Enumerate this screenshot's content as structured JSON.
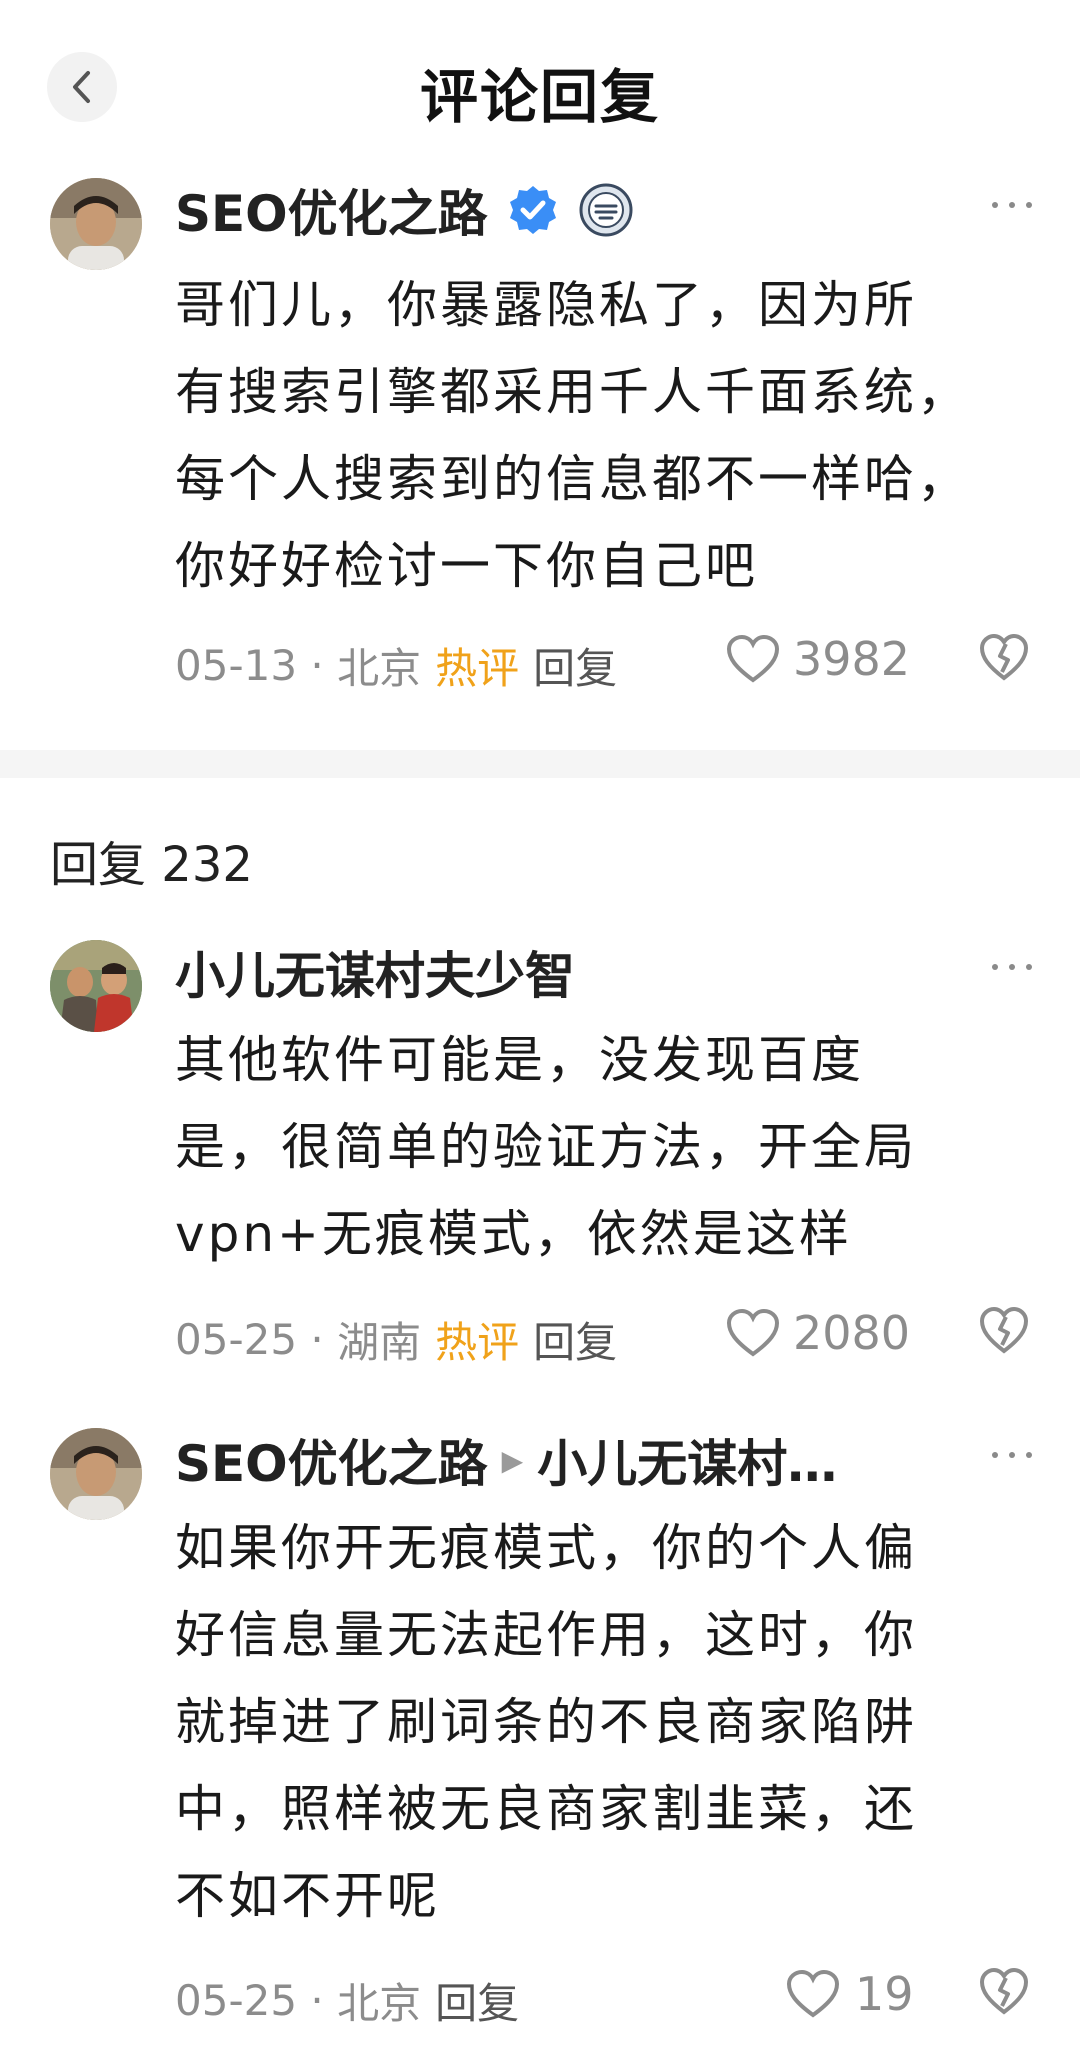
{
  "header": {
    "title": "评论回复",
    "back_icon": "chevron-left-icon"
  },
  "main_comment": {
    "author": "SEO优化之路",
    "verified_icon": "verified-badge-icon",
    "level_icon": "fan-badge-icon",
    "text_lines": [
      "哥们儿，你暴露隐私了，因为所",
      "有搜索引擎都采用千人千面系统，",
      "每个人搜索到的信息都不一样哈，",
      "你好好检讨一下你自己吧"
    ],
    "date": "05-13",
    "location": "北京",
    "hot_label": "热评",
    "reply_label": "回复",
    "likes": "3982"
  },
  "replies_header": {
    "label": "回复",
    "count": "232"
  },
  "replies": [
    {
      "author": "小儿无谋村夫少智",
      "text_lines": [
        "其他软件可能是，没发现百度",
        "是，很简单的验证方法，开全局",
        "vpn+无痕模式，依然是这样"
      ],
      "date": "05-25",
      "location": "湖南",
      "hot_label": "热评",
      "reply_label": "回复",
      "likes": "2080"
    },
    {
      "author": "SEO优化之路",
      "reply_to": "小儿无谋村…",
      "text_lines": [
        "如果你开无痕模式，你的个人偏",
        "好信息量无法起作用，这时，你",
        "就掉进了刷词条的不良商家陷阱",
        "中，照样被无良商家割韭菜，还",
        "不如不开呢"
      ],
      "date": "05-25",
      "location": "北京",
      "reply_label": "回复",
      "likes": "19"
    }
  ],
  "colors": {
    "hot": "#f0a21a",
    "meta": "#8c8c8c",
    "verified": "#3a8ef6"
  }
}
